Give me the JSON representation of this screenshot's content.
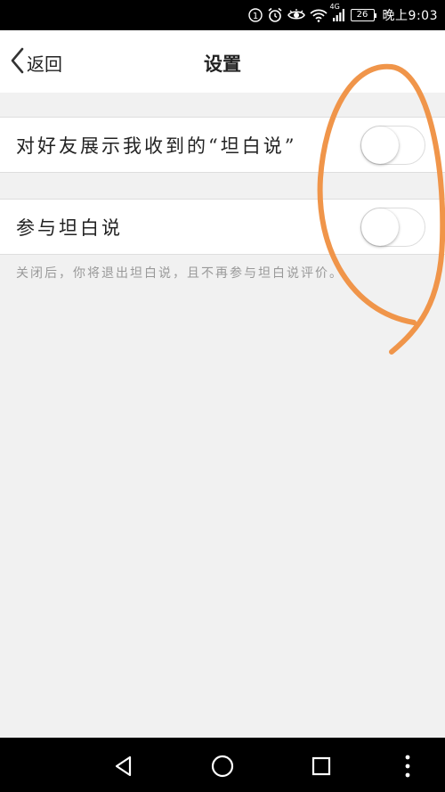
{
  "status_bar": {
    "badge": "1",
    "network": "4G",
    "battery": "26",
    "time": "晚上9:03",
    "icons": [
      "notification-badge-icon",
      "alarm-icon",
      "eye-icon",
      "wifi-icon",
      "signal-icon",
      "battery-icon"
    ]
  },
  "header": {
    "back_label": "返回",
    "title": "设置"
  },
  "settings": [
    {
      "label": "对好友展示我收到的“坦白说”",
      "enabled": false
    },
    {
      "label": "参与坦白说",
      "enabled": false
    }
  ],
  "hint": "关闭后，你将退出坦白说，且不再参与坦白说评价。",
  "colors": {
    "annotation_stroke": "#f0954a",
    "background": "#f1f1f1"
  },
  "system_nav": {
    "icons": [
      "back-triangle-icon",
      "home-circle-icon",
      "recents-square-icon",
      "more-dots-icon"
    ]
  }
}
